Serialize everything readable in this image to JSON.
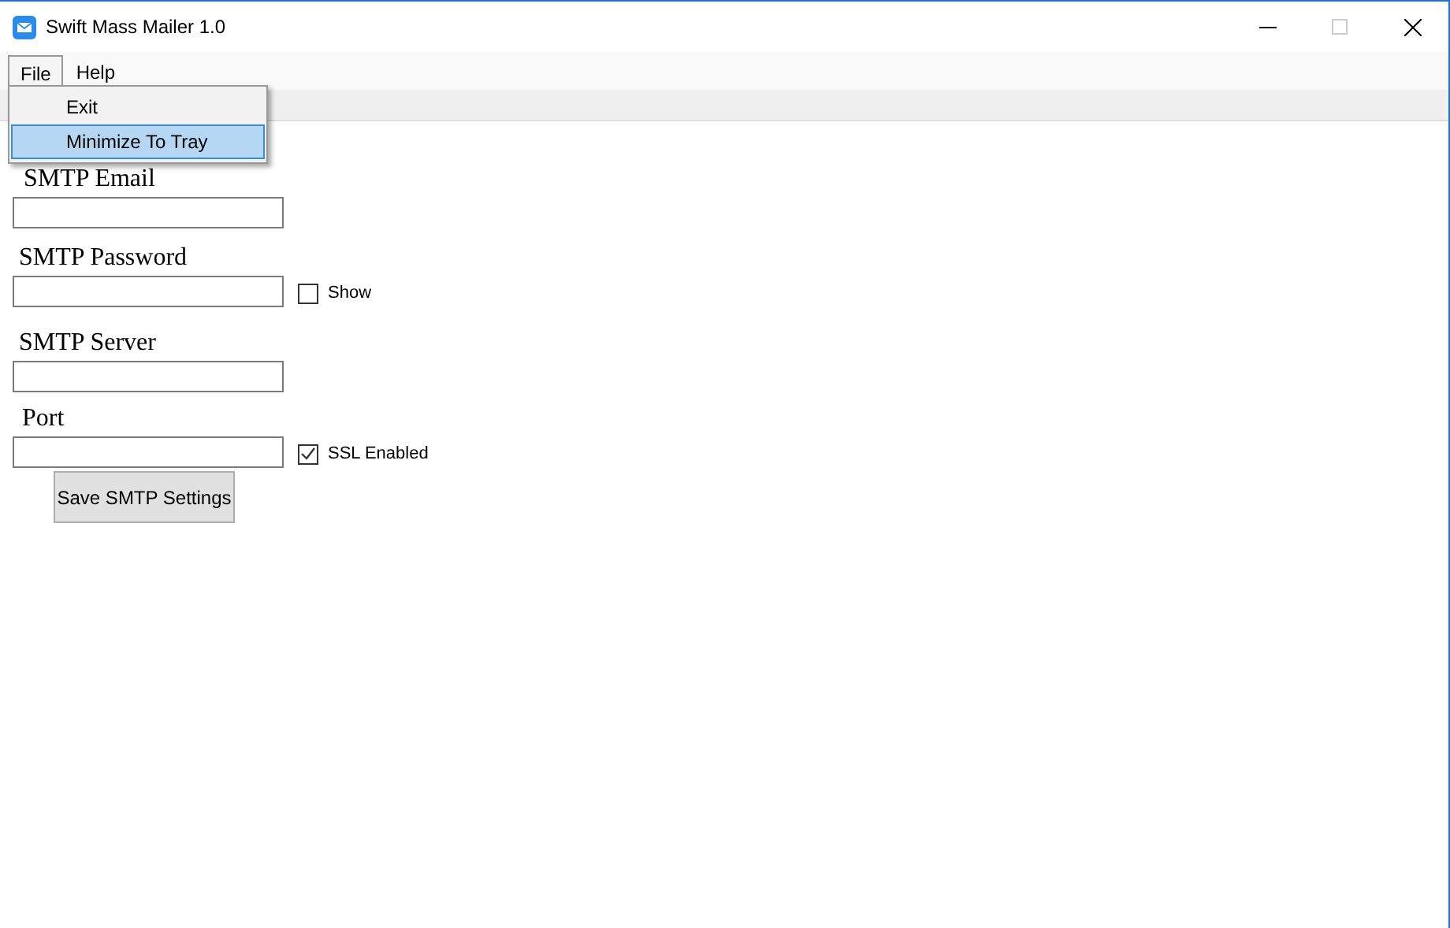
{
  "window": {
    "title": "Swift Mass Mailer 1.0"
  },
  "menu": [
    {
      "label": "File",
      "selected": true
    },
    {
      "label": "Help",
      "selected": false
    }
  ],
  "dropdown": [
    {
      "label": "Exit",
      "selected": false
    },
    {
      "label": "Minimize To Tray",
      "selected": true
    }
  ],
  "fields": [
    {
      "label": "SMTP Email"
    },
    {
      "label": "SMTP Password",
      "checkbox": {
        "label": "Show",
        "checked": false
      }
    },
    {
      "label": "SMTP Server"
    },
    {
      "label": "Port",
      "checkbox": {
        "label": "SSL Enabled",
        "checked": true
      }
    }
  ],
  "save_button": "Save SMTP Settings"
}
